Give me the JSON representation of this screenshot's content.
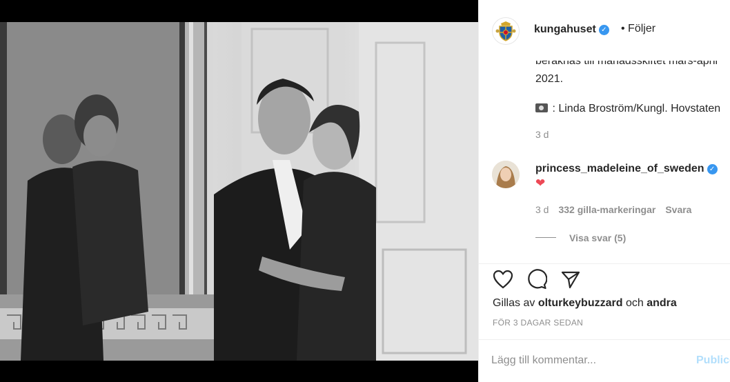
{
  "post": {
    "author": "kungahuset",
    "follow_label": "• Följer",
    "photo_alt": ""
  },
  "caption": {
    "line_cut": "beräknas till månadsskiftet mars-april",
    "line_year": "2021.",
    "photo_credit": ": Linda Broström/Kungl. Hovstaten",
    "time": "3 d"
  },
  "comment": {
    "user": "princess_madeleine_of_sweden",
    "text": "❤",
    "time": "3 d",
    "likes": "332 gilla-markeringar",
    "reply_label": "Svara",
    "view_replies": "Visa svar (5)"
  },
  "actions": {
    "liked_by_prefix": "Gillas av",
    "liked_by_user": "olturkeybuzzard",
    "liked_by_and": "och",
    "liked_by_others": "andra",
    "timestamp": "FÖR 3 DAGAR SEDAN"
  },
  "add_comment": {
    "placeholder": "Lägg till kommentar...",
    "publish_label": "Publicera"
  },
  "icons": [
    "crest-icon",
    "verified-icon",
    "camera-icon",
    "heart-icon",
    "comment-icon",
    "share-icon"
  ],
  "colors": {
    "link_blue": "#3897f0",
    "heart_red": "#ed4956",
    "publish_disabled": "#b2dffc"
  }
}
